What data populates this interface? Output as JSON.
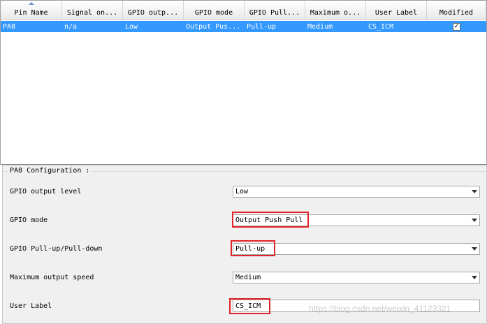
{
  "table": {
    "columns": [
      "Pin Name",
      "Signal on...",
      "GPIO outp...",
      "GPIO mode",
      "GPIO Pull...",
      "Maximum o...",
      "User Label",
      "Modified"
    ],
    "rows": [
      {
        "pin": "PA8",
        "signal": "n/a",
        "output_level": "Low",
        "mode": "Output Pus...",
        "pull": "Pull-up",
        "speed": "Medium",
        "label": "CS_ICM",
        "modified": "✓"
      }
    ]
  },
  "config": {
    "title": "PA8 Configuration :",
    "output_level": {
      "label": "GPIO output level",
      "value": "Low"
    },
    "mode": {
      "label": "GPIO mode",
      "value": "Output Push Pull"
    },
    "pull": {
      "label": "GPIO Pull-up/Pull-down",
      "value": "Pull-up"
    },
    "speed": {
      "label": "Maximum output speed",
      "value": "Medium"
    },
    "user_label": {
      "label": "User Label",
      "value": "CS_ICM"
    }
  },
  "colors": {
    "selection": "#3399ff",
    "highlight": "#e0242b"
  },
  "icons": {
    "sort": "sort-ascending-icon",
    "dropdown": "chevron-down-icon",
    "check": "checkmark-icon"
  },
  "watermark": "https://blog.csdn.net/weixin_41123321"
}
